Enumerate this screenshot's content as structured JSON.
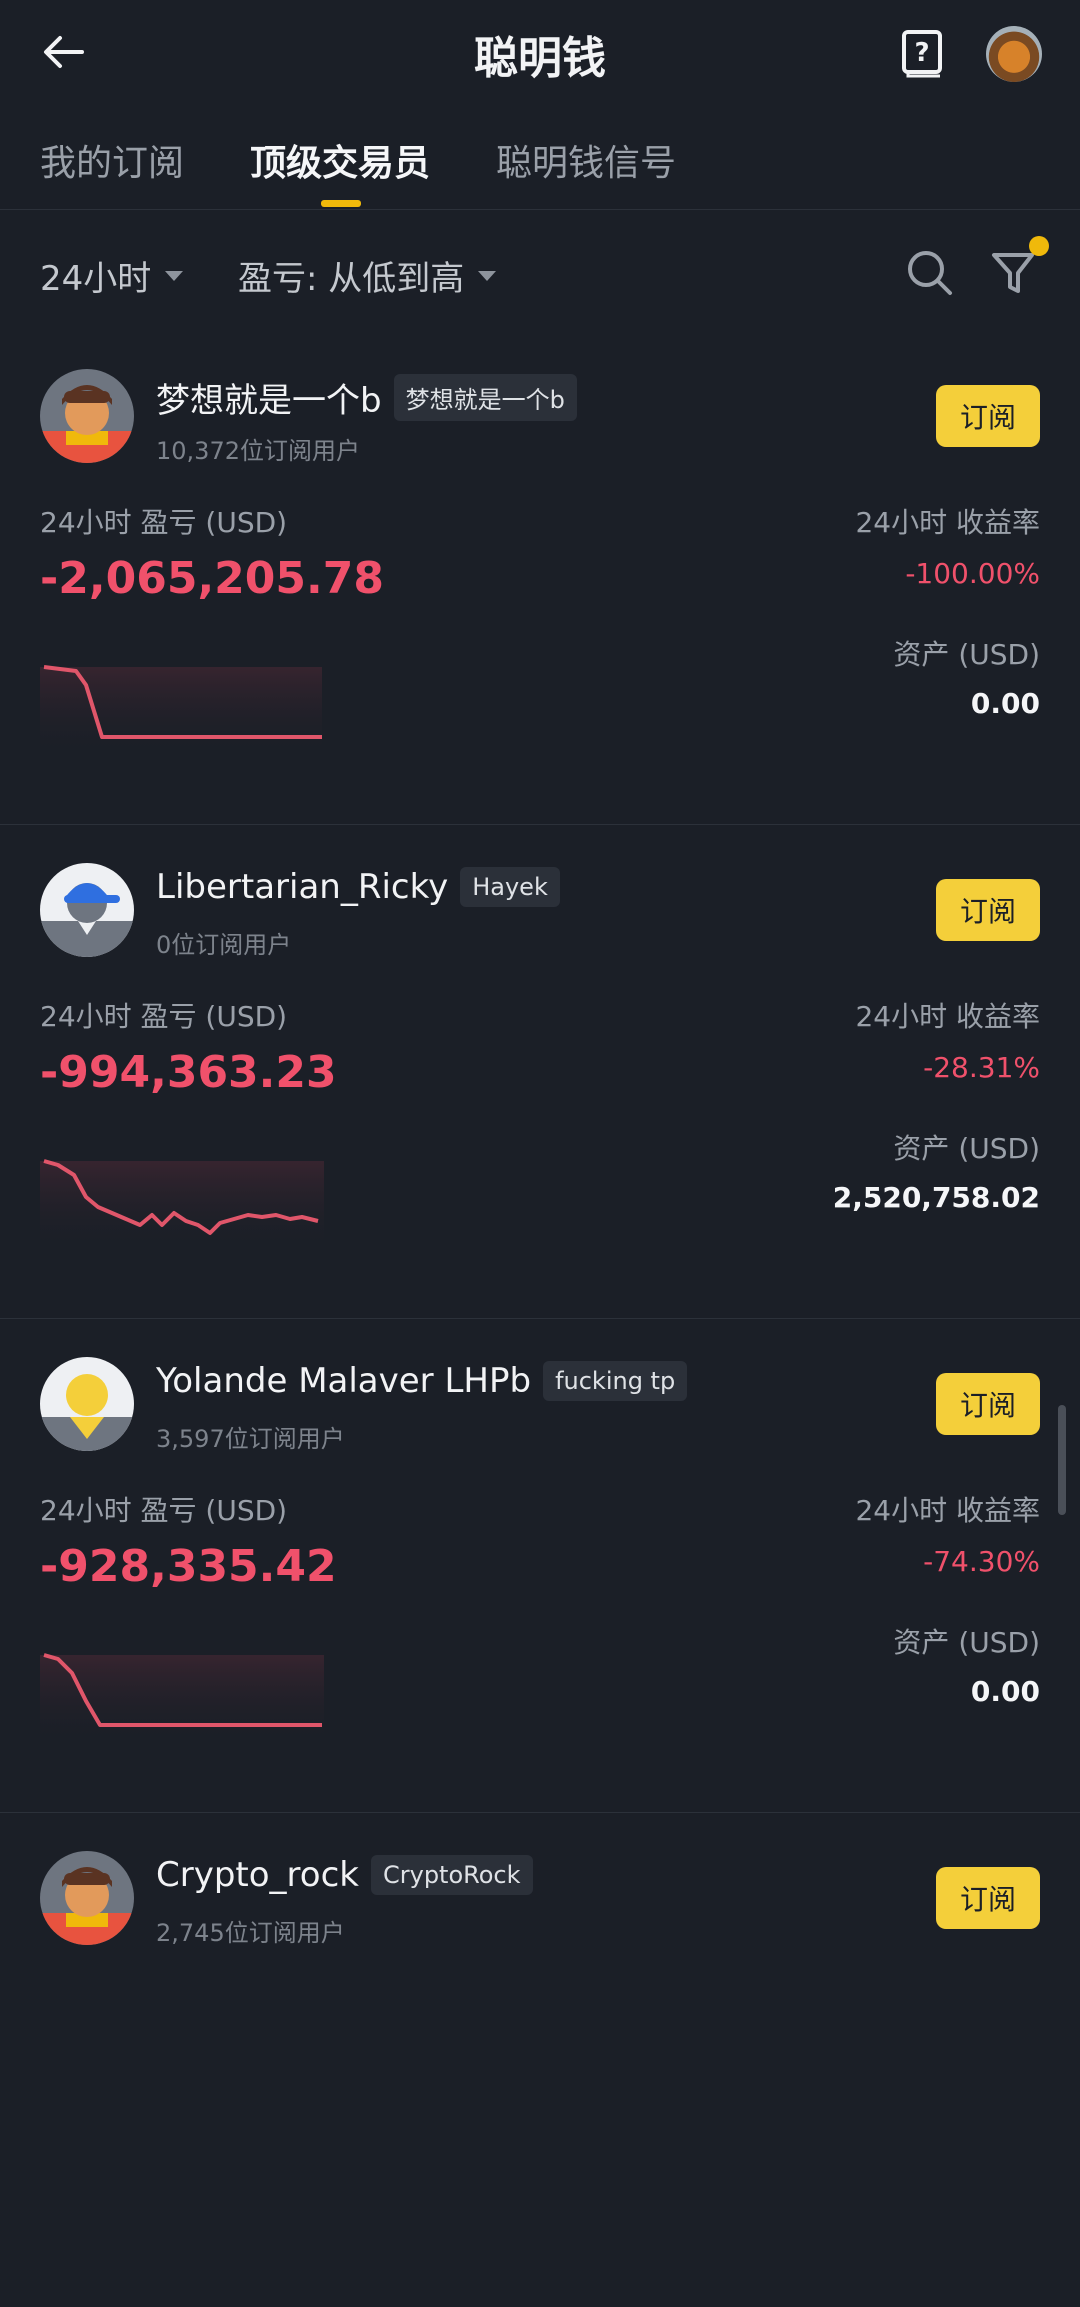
{
  "header": {
    "title": "聪明钱"
  },
  "tabs": [
    {
      "label": "我的订阅"
    },
    {
      "label": "顶级交易员"
    },
    {
      "label": "聪明钱信号"
    }
  ],
  "filters": {
    "period": "24小时",
    "sort": "盈亏: 从低到高"
  },
  "accent_color": "#f0b90b",
  "loss_color": "#f0516b",
  "traders": [
    {
      "name": "梦想就是一个b",
      "tag": "梦想就是一个b",
      "subscribers": "10,372位订阅用户",
      "subscribe_label": "订阅",
      "pnl_label": "24小时 盈亏 (USD)",
      "pnl_value": "-2,065,205.78",
      "roi_label": "24小时 收益率",
      "roi_value": "-100.00%",
      "assets_label": "资产 (USD)",
      "assets_value": "0.00",
      "avatar_icon": "cartoon-person-avatar-icon"
    },
    {
      "name": "Libertarian_Ricky",
      "tag": "Hayek",
      "subscribers": "0位订阅用户",
      "subscribe_label": "订阅",
      "pnl_label": "24小时 盈亏 (USD)",
      "pnl_value": "-994,363.23",
      "roi_label": "24小时 收益率",
      "roi_value": "-28.31%",
      "assets_label": "资产 (USD)",
      "assets_value": "2,520,758.02",
      "avatar_icon": "cap-person-avatar-icon"
    },
    {
      "name": "Yolande Malaver LHPb",
      "tag": "fucking tp",
      "subscribers": "3,597位订阅用户",
      "subscribe_label": "订阅",
      "pnl_label": "24小时 盈亏 (USD)",
      "pnl_value": "-928,335.42",
      "roi_label": "24小时 收益率",
      "roi_value": "-74.30%",
      "assets_label": "资产 (USD)",
      "assets_value": "0.00",
      "avatar_icon": "yellow-person-avatar-icon"
    },
    {
      "name": "Crypto_rock",
      "tag": "CryptoRock",
      "subscribers": "2,745位订阅用户",
      "subscribe_label": "订阅",
      "avatar_icon": "cartoon-person-avatar-icon"
    }
  ]
}
